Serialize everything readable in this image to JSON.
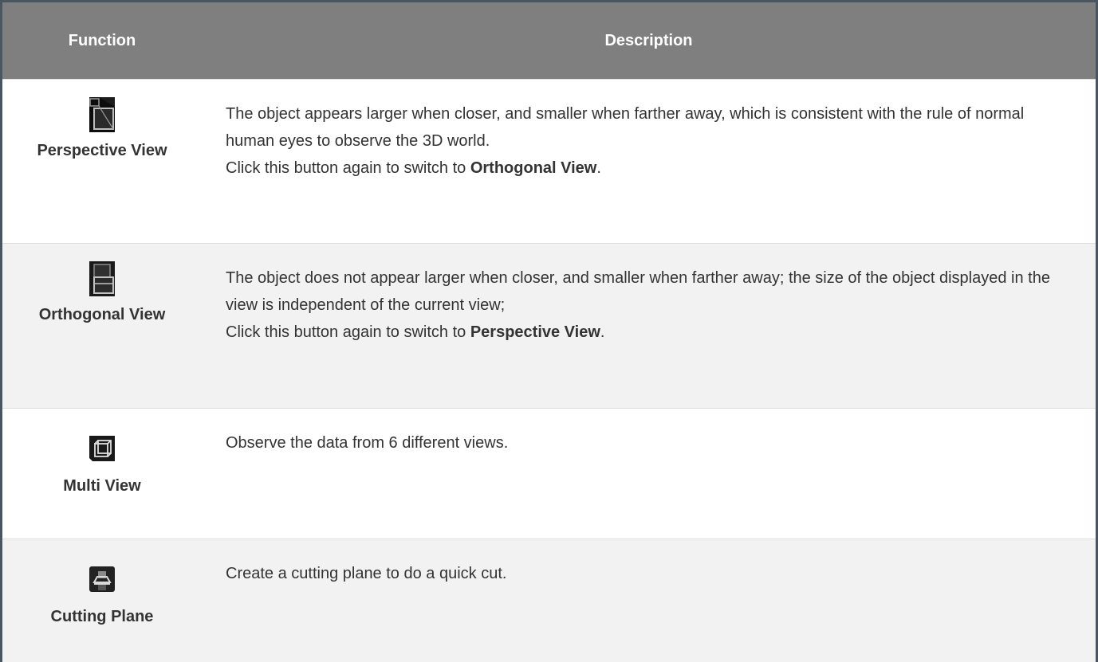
{
  "table": {
    "headers": {
      "function": "Function",
      "description": "Description"
    },
    "rows": [
      {
        "icon": "perspective-view-icon",
        "name": "Perspective View",
        "lines": [
          "The object appears larger when closer, and smaller when farther away, which is consistent with the rule of normal human eyes to observe the 3D world."
        ],
        "switch_prefix": "Click this button again to switch to ",
        "switch_target": "Orthogonal View",
        "switch_suffix": "."
      },
      {
        "icon": "orthogonal-view-icon",
        "name": "Orthogonal View",
        "lines": [
          "The object does not appear larger when closer, and smaller when farther away; the size of the object displayed in the view is independent of the current view;"
        ],
        "switch_prefix": "Click this button again to switch to ",
        "switch_target": "Perspective View",
        "switch_suffix": "."
      },
      {
        "icon": "multi-view-icon",
        "name": "Multi View",
        "lines": [
          "Observe the data from 6 different views."
        ]
      },
      {
        "icon": "cutting-plane-icon",
        "name": "Cutting Plane",
        "lines": [
          "Create a cutting plane to do a quick cut."
        ]
      }
    ]
  }
}
